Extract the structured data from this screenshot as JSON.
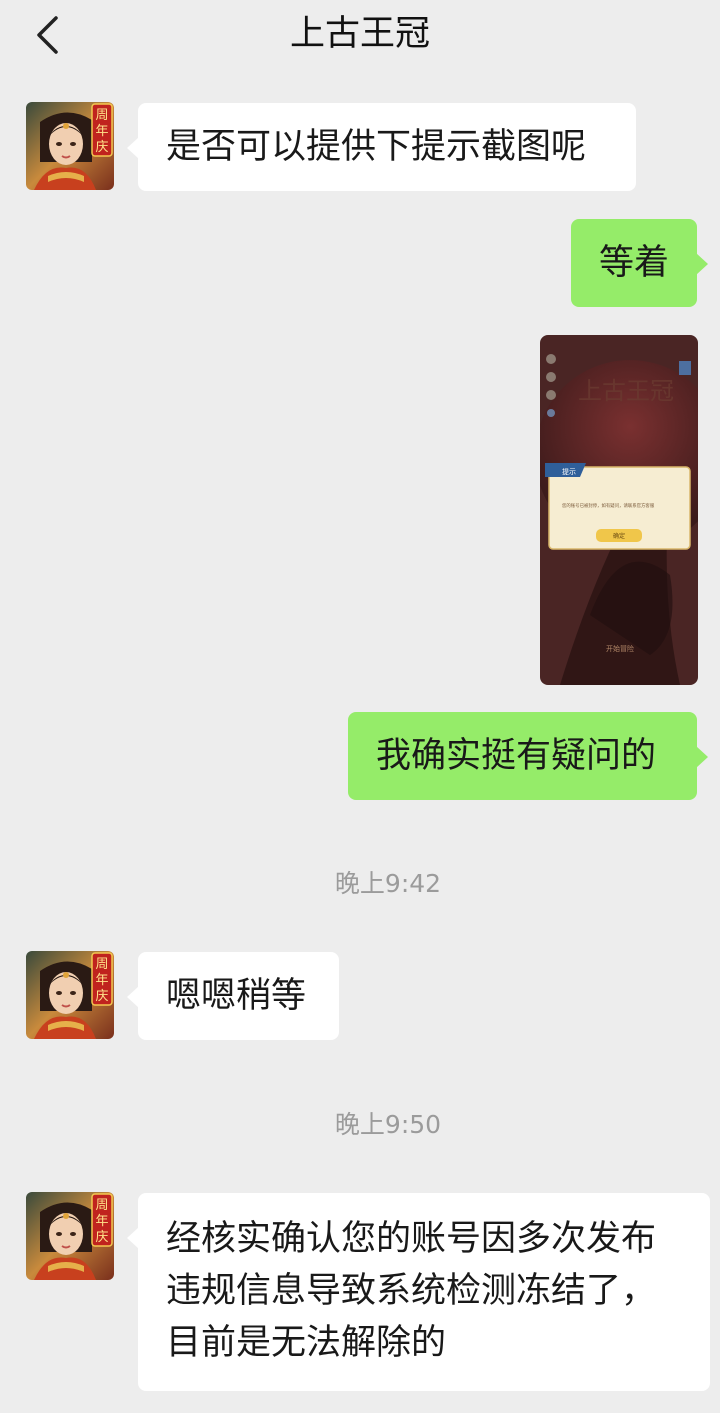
{
  "header": {
    "title": "上古王冠",
    "back_icon": "chevron-left-icon"
  },
  "avatar": {
    "badge_text": "周年庆"
  },
  "messages": [
    {
      "side": "left",
      "text": "是否可以提供下提示截图呢"
    },
    {
      "side": "right",
      "text": "等着"
    },
    {
      "side": "right",
      "type": "image",
      "screenshot": {
        "game_logo": "上古王冠",
        "dialog_title": "提示",
        "dialog_text": "您的账号已被封停，如有疑问，请联系官方客服",
        "confirm_label": "确定",
        "start_label": "开始冒险"
      }
    },
    {
      "side": "right",
      "text": "我确实挺有疑问的"
    },
    {
      "type": "time",
      "text": "晚上9:42"
    },
    {
      "side": "left",
      "text": "嗯嗯稍等"
    },
    {
      "type": "time",
      "text": "晚上9:50"
    },
    {
      "side": "left",
      "lines": [
        "经核实确认您的账号因多次发布",
        "违规信息导致系统检测冻结了，",
        "目前是无法解除的"
      ]
    }
  ],
  "colors": {
    "background": "#ededed",
    "bubble_left": "#ffffff",
    "bubble_right": "#95ec69",
    "time_text": "#9b9b9b"
  }
}
